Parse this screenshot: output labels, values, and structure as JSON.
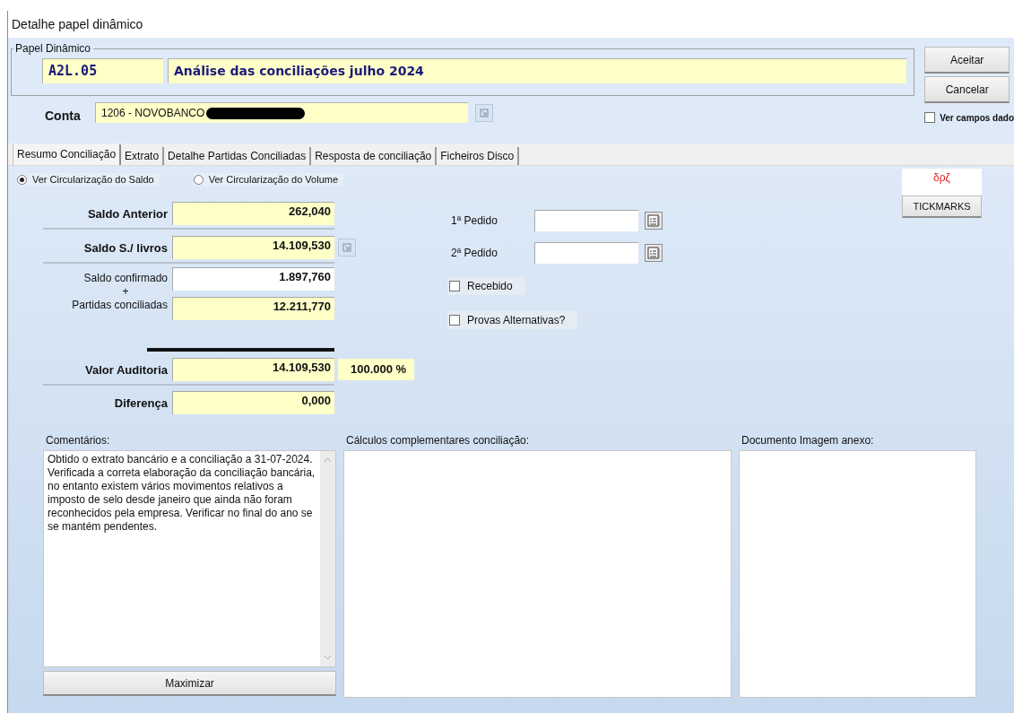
{
  "window": {
    "title": "Detalhe papel dinâmico"
  },
  "papel_dinamico": {
    "legend": "Papel Dinâmico",
    "code": "A2L.05",
    "description": "Análise das conciliações julho 2024"
  },
  "buttons": [
    "Aceitar",
    "Cancelar"
  ],
  "ver_campos": {
    "label": "Ver campos dado",
    "checked": false
  },
  "conta": {
    "label": "Conta",
    "value": "1206 - NOVOBANCO",
    "redacted": true
  },
  "tabs": [
    {
      "label": "Resumo Conciliação",
      "selected": true
    },
    {
      "label": "Extrato",
      "selected": false
    },
    {
      "label": "Detalhe Partidas Conciliadas",
      "selected": false
    },
    {
      "label": "Resposta de conciliação",
      "selected": false
    },
    {
      "label": "Ficheiros Disco",
      "selected": false
    }
  ],
  "view_options": [
    {
      "label": "Ver Circularização do Saldo",
      "selected": true
    },
    {
      "label": "Ver Circularização do Volume",
      "selected": false
    }
  ],
  "balances": [
    {
      "label": "Saldo Anterior",
      "value": "262,040",
      "lookup": false
    },
    {
      "label": "Saldo S./ livros",
      "value": "14.109,530",
      "lookup": true
    }
  ],
  "reconciliation": {
    "labels": [
      "Saldo confirmado",
      "+",
      "Partidas conciliadas"
    ],
    "values": [
      {
        "value": "1.897,760",
        "editable": true
      },
      {
        "value": "12.211,770",
        "editable": false
      }
    ]
  },
  "results": [
    {
      "label": "Valor Auditoria",
      "value": "14.109,530",
      "percent": "100.000 %"
    },
    {
      "label": "Diferença",
      "value": "0,000"
    }
  ],
  "requests": [
    {
      "label": "1ª Pedido"
    },
    {
      "label": "2ª Pedido"
    }
  ],
  "checks": [
    {
      "label": "Recebido",
      "checked": false
    },
    {
      "label": "Provas Alternativas?",
      "checked": false
    }
  ],
  "tickmarks": {
    "symbols": "δρζ",
    "button": "TICKMARKS"
  },
  "comments": {
    "label": "Comentários:",
    "text": "Obtido o extrato bancário e a conciliação a 31-07-2024. Verificada a correta elaboração da conciliação bancária, no entanto existem vários movimentos relativos a imposto de selo desde janeiro que ainda não foram reconhecidos pela empresa. Verificar no final do ano se se mantém pendentes.",
    "button": "Maximizar"
  },
  "calculations": {
    "label": "Cálculos complementares conciliação:"
  },
  "attachment": {
    "label": "Documento Imagem anexo:"
  }
}
